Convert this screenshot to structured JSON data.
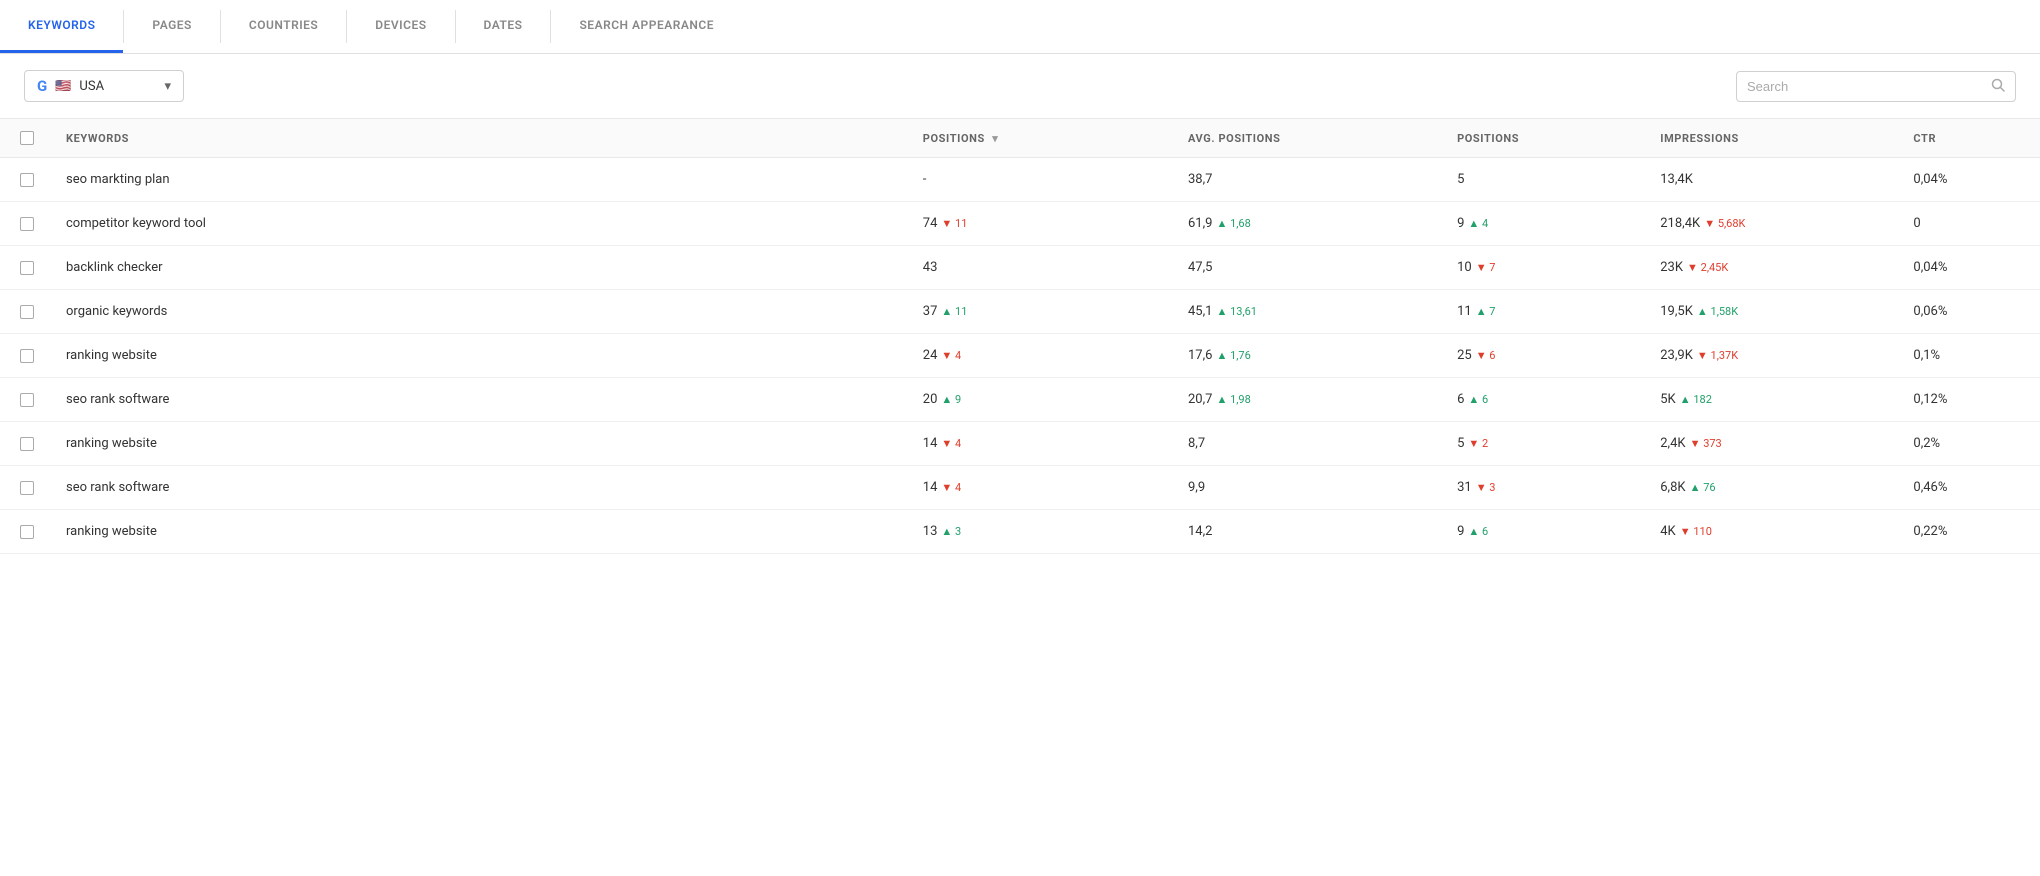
{
  "tabs": [
    {
      "label": "KEYWORDS",
      "active": true
    },
    {
      "label": "PAGES",
      "active": false
    },
    {
      "label": "COUNTRIES",
      "active": false
    },
    {
      "label": "DEVICES",
      "active": false
    },
    {
      "label": "DATES",
      "active": false
    },
    {
      "label": "SEARCH APPEARANCE",
      "active": false
    }
  ],
  "toolbar": {
    "country_selector": {
      "value": "USA",
      "placeholder": "USA"
    },
    "search": {
      "placeholder": "Search"
    }
  },
  "table": {
    "headers": [
      {
        "label": "",
        "key": "checkbox"
      },
      {
        "label": "KEYWORDS",
        "key": "keyword"
      },
      {
        "label": "POSITIONS",
        "key": "positions",
        "sortable": true
      },
      {
        "label": "AVG. POSITIONS",
        "key": "avg_positions"
      },
      {
        "label": "POSITIONS",
        "key": "positions2"
      },
      {
        "label": "IMPRESSIONS",
        "key": "impressions"
      },
      {
        "label": "CTR",
        "key": "ctr"
      }
    ],
    "rows": [
      {
        "keyword": "seo markting plan",
        "positions": "-",
        "positions_change": null,
        "positions_dir": null,
        "avg_positions": "38,7",
        "avg_change": null,
        "avg_dir": null,
        "positions2": "5",
        "pos2_change": null,
        "pos2_dir": null,
        "impressions": "13,4K",
        "imp_change": null,
        "imp_dir": null,
        "ctr": "0,04%",
        "ctr_change": null,
        "ctr_dir": null
      },
      {
        "keyword": "competitor keyword tool",
        "positions": "74",
        "positions_change": "11",
        "positions_dir": "down",
        "avg_positions": "61,9",
        "avg_change": "1,68",
        "avg_dir": "up",
        "positions2": "9",
        "pos2_change": "4",
        "pos2_dir": "up",
        "impressions": "218,4K",
        "imp_change": "5,68K",
        "imp_dir": "down",
        "ctr": "0",
        "ctr_change": null,
        "ctr_dir": null
      },
      {
        "keyword": "backlink checker",
        "positions": "43",
        "positions_change": null,
        "positions_dir": null,
        "avg_positions": "47,5",
        "avg_change": null,
        "avg_dir": null,
        "positions2": "10",
        "pos2_change": "7",
        "pos2_dir": "down",
        "impressions": "23K",
        "imp_change": "2,45K",
        "imp_dir": "down",
        "ctr": "0,04%",
        "ctr_change": null,
        "ctr_dir": null
      },
      {
        "keyword": "organic keywords",
        "positions": "37",
        "positions_change": "11",
        "positions_dir": "up",
        "avg_positions": "45,1",
        "avg_change": "13,61",
        "avg_dir": "up",
        "positions2": "11",
        "pos2_change": "7",
        "pos2_dir": "up",
        "impressions": "19,5K",
        "imp_change": "1,58K",
        "imp_dir": "up",
        "ctr": "0,06%",
        "ctr_change": null,
        "ctr_dir": null
      },
      {
        "keyword": "ranking website",
        "positions": "24",
        "positions_change": "4",
        "positions_dir": "down",
        "avg_positions": "17,6",
        "avg_change": "1,76",
        "avg_dir": "up",
        "positions2": "25",
        "pos2_change": "6",
        "pos2_dir": "down",
        "impressions": "23,9K",
        "imp_change": "1,37K",
        "imp_dir": "down",
        "ctr": "0,1%",
        "ctr_change": null,
        "ctr_dir": null
      },
      {
        "keyword": "seo rank software",
        "positions": "20",
        "positions_change": "9",
        "positions_dir": "up",
        "avg_positions": "20,7",
        "avg_change": "1,98",
        "avg_dir": "up",
        "positions2": "6",
        "pos2_change": "6",
        "pos2_dir": "up",
        "impressions": "5K",
        "imp_change": "182",
        "imp_dir": "up",
        "ctr": "0,12%",
        "ctr_change": null,
        "ctr_dir": null
      },
      {
        "keyword": "ranking website",
        "positions": "14",
        "positions_change": "4",
        "positions_dir": "down",
        "avg_positions": "8,7",
        "avg_change": null,
        "avg_dir": null,
        "positions2": "5",
        "pos2_change": "2",
        "pos2_dir": "down",
        "impressions": "2,4K",
        "imp_change": "373",
        "imp_dir": "down",
        "ctr": "0,2%",
        "ctr_change": null,
        "ctr_dir": null
      },
      {
        "keyword": "seo rank software",
        "positions": "14",
        "positions_change": "4",
        "positions_dir": "down",
        "avg_positions": "9,9",
        "avg_change": null,
        "avg_dir": null,
        "positions2": "31",
        "pos2_change": "3",
        "pos2_dir": "down",
        "impressions": "6,8K",
        "imp_change": "76",
        "imp_dir": "up",
        "ctr": "0,46%",
        "ctr_change": null,
        "ctr_dir": null
      },
      {
        "keyword": "ranking website",
        "positions": "13",
        "positions_change": "3",
        "positions_dir": "up",
        "avg_positions": "14,2",
        "avg_change": null,
        "avg_dir": null,
        "positions2": "9",
        "pos2_change": "6",
        "pos2_dir": "up",
        "impressions": "4K",
        "imp_change": "110",
        "imp_dir": "down",
        "ctr": "0,22%",
        "ctr_change": null,
        "ctr_dir": null
      }
    ]
  },
  "icons": {
    "google": "G",
    "flag_usa": "🇺🇸",
    "chevron_down": "▾",
    "search": "🔍",
    "sort_down": "▾"
  }
}
